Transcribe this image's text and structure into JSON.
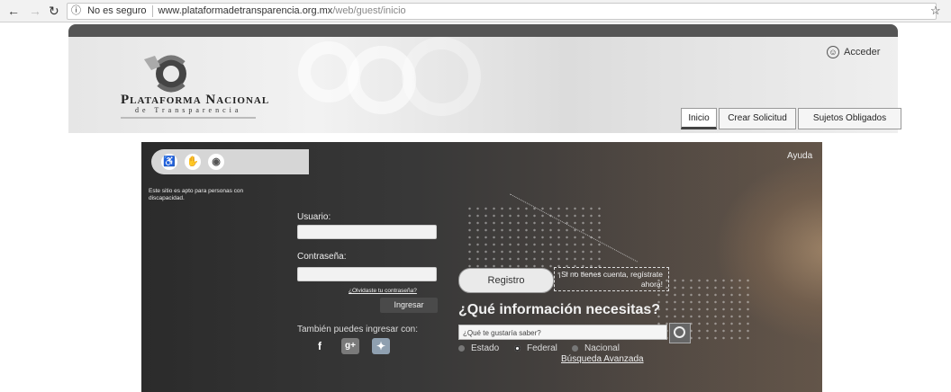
{
  "browser": {
    "security_label": "No es seguro",
    "url_host": "www.plataformadetransparencia.org.mx",
    "url_path": "/web/guest/inicio"
  },
  "header": {
    "logo_title": "Plataforma Nacional",
    "logo_subtitle": "de Transparencia",
    "acceder": "Acceder",
    "tabs": [
      {
        "label": "Inicio"
      },
      {
        "label": "Crear Solicitud"
      },
      {
        "label": "Sujetos Obligados"
      }
    ]
  },
  "panel": {
    "ayuda": "Ayuda",
    "accessibility_note": "Este sitio es apto para personas con discapacidad.",
    "login": {
      "user_label": "Usuario:",
      "password_label": "Contraseña:",
      "forgot": "¿Olvidaste tu contraseña?",
      "submit": "Ingresar",
      "also_label": "También puedes ingresar con:"
    },
    "register": {
      "button": "Registro",
      "note": "¡Si no tienes cuenta, regístrate ahora!"
    },
    "search": {
      "question": "¿Qué información necesitas?",
      "placeholder": "¿Qué te gustaría saber?",
      "options": [
        {
          "label": "Estado",
          "selected": false
        },
        {
          "label": "Federal",
          "selected": true
        },
        {
          "label": "Nacional",
          "selected": false
        }
      ],
      "advanced": "Búsqueda Avanzada"
    }
  }
}
